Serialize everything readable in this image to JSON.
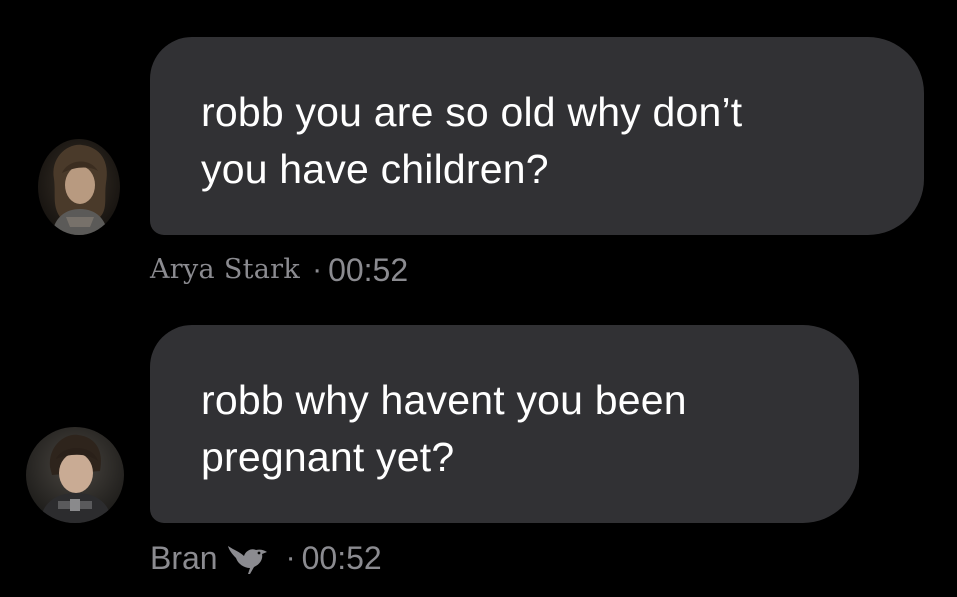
{
  "messages": [
    {
      "lines": [
        "robb you are so old why don’t",
        "you have children?"
      ],
      "sender": "Arya Stark",
      "separator": "·",
      "time": "00:52",
      "avatar_icon": "avatar-portrait-long-hair"
    },
    {
      "lines": [
        "robb why havent you been",
        "pregnant yet?"
      ],
      "sender": "Bran",
      "badge_icon": "crow-icon",
      "separator": "·",
      "time": "00:52",
      "avatar_icon": "avatar-portrait-short-hair"
    }
  ],
  "colors": {
    "background": "#000000",
    "bubble": "#313134",
    "text": "#ffffff",
    "meta": "#8b8b90"
  }
}
